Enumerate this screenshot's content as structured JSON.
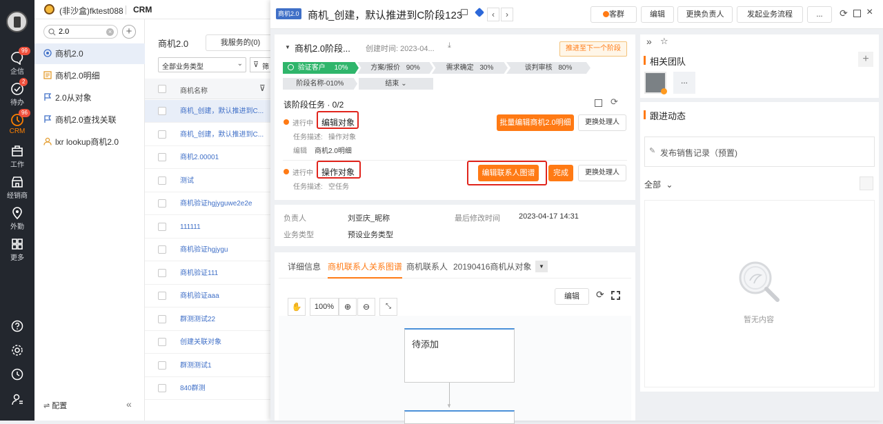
{
  "rail": {
    "items": [
      {
        "label": "企信",
        "badge": "99"
      },
      {
        "label": "待办",
        "badge": "2"
      },
      {
        "label": "CRM",
        "badge": "96"
      },
      {
        "label": "工作"
      },
      {
        "label": "经销商"
      },
      {
        "label": "外勤"
      },
      {
        "label": "更多"
      }
    ]
  },
  "topbar": {
    "org": "(非沙盒)fktest088",
    "app": "CRM"
  },
  "search": {
    "value": "2.0"
  },
  "sidenav": {
    "items": [
      {
        "label": "商机2.0"
      },
      {
        "label": "商机2.0明细"
      },
      {
        "label": "2.0从对象"
      },
      {
        "label": "商机2.0查找关联"
      },
      {
        "label": "lxr lookup商机2.0"
      }
    ],
    "config": "配置"
  },
  "list": {
    "title": "商机2.0",
    "scope_button": "我服务的(0)",
    "type_select": "全部业务类型",
    "filter_label": "筛",
    "column": "商机名称",
    "rows": [
      "商机_创建，默认推进到C...",
      "商机_创建，默认推进到C...",
      "商机2.00001",
      "测试",
      "商机验证hgjyguwe2e2e",
      "111111",
      "商机验证hgjygu",
      "商机验证111",
      "商机验证aaa",
      "群测测试22",
      "创建关联对象",
      "群测测试1",
      "840群测"
    ]
  },
  "detail": {
    "tag": "商机2.0",
    "title": "商机_创建，默认推进到C阶段123",
    "actions": {
      "customer": "客群",
      "edit": "编辑",
      "change_owner": "更换负责人",
      "start_flow": "发起业务流程",
      "more": "..."
    },
    "stage_card": {
      "title": "商机2.0阶段...",
      "created": "创建时间: 2023-04...",
      "advance_button": "推进至下一个阶段",
      "stages": [
        {
          "name": "验证客户",
          "pct": "10%"
        },
        {
          "name": "方案/报价",
          "pct": "90%"
        },
        {
          "name": "需求确定",
          "pct": "30%"
        },
        {
          "name": "谈判审核",
          "pct": "80%"
        },
        {
          "name": "阶段名称-01",
          "pct": "0%"
        }
      ],
      "end_label": "结束",
      "tasks_header": "该阶段任务 · 0/2",
      "tasks": [
        {
          "status": "进行中",
          "name": "编辑对象",
          "desc_label": "任务描述:",
          "desc": "操作对象",
          "extra_label": "编辑",
          "extra": "商机2.0明细",
          "primary": "批量编辑商机2.0明细",
          "secondary": "更换处理人"
        },
        {
          "status": "进行中",
          "name": "操作对象",
          "desc_label": "任务描述:",
          "desc": "空任务",
          "primary": "编辑联系人图谱",
          "done": "完成",
          "secondary": "更换处理人"
        }
      ]
    },
    "info": {
      "owner_label": "负责人",
      "owner": "刘亚庆_昵称",
      "modified_label": "最后修改时间",
      "modified": "2023-04-17 14:31",
      "type_label": "业务类型",
      "type": "预设业务类型"
    },
    "tabs": [
      "详细信息",
      "商机联系人关系图谱",
      "商机联系人",
      "20190416商机从对象"
    ],
    "graph": {
      "zoom": "100%",
      "edit": "编辑",
      "node": "待添加"
    },
    "right": {
      "team_title": "相关团队",
      "more": "...",
      "dynamic_title": "跟进动态",
      "post_placeholder": "发布销售记录（预置)",
      "filter": "全部",
      "empty": "暂无内容"
    }
  },
  "colors": {
    "accent": "#ff7a14",
    "stage_done": "#2fb56b",
    "link": "#3f6fc7",
    "rail": "#23272e"
  }
}
